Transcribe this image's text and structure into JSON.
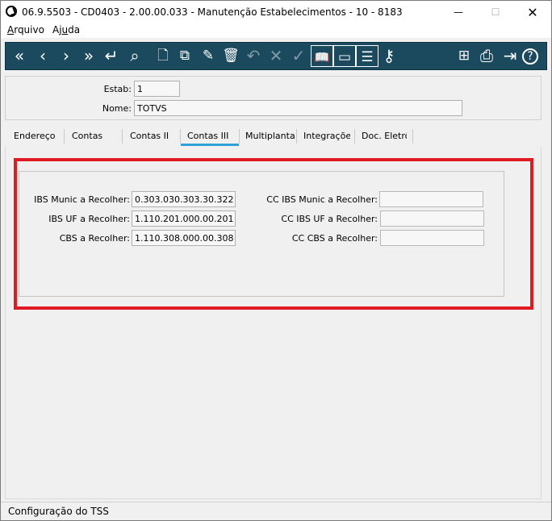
{
  "window": {
    "title": "06.9.5503 - CD0403 - 2.00.00.033 - Manutenção Estabelecimentos - 10 - 8183",
    "minimize": "—",
    "maximize": "☐",
    "close": "✕"
  },
  "menu": {
    "items": [
      {
        "label_u": "A",
        "label_rest": "rquivo"
      },
      {
        "label_pre": "Aj",
        "label_u": "u",
        "label_rest": "da"
      }
    ]
  },
  "toolbar": {
    "buttons": [
      {
        "icon": "first-record-icon",
        "glyph": "«"
      },
      {
        "icon": "previous-record-icon",
        "glyph": "‹"
      },
      {
        "icon": "next-record-icon",
        "glyph": "›"
      },
      {
        "icon": "last-record-icon",
        "glyph": "»"
      },
      {
        "icon": "goto-record-icon",
        "glyph": "↵"
      },
      {
        "icon": "search-icon",
        "glyph": "⌕"
      },
      {
        "icon": "new-record-icon",
        "glyph": "🗋"
      },
      {
        "icon": "copy-record-icon",
        "glyph": "⧉"
      },
      {
        "icon": "edit-record-icon",
        "glyph": "✎"
      },
      {
        "icon": "delete-record-icon",
        "glyph": "🗑"
      },
      {
        "icon": "undo-icon",
        "glyph": "↶"
      },
      {
        "icon": "cancel-icon",
        "glyph": "✕"
      },
      {
        "icon": "save-icon",
        "glyph": "✓"
      },
      {
        "icon": "book-icon",
        "glyph": "📖"
      },
      {
        "icon": "cast-icon",
        "glyph": "▭"
      },
      {
        "icon": "settings-sliders-icon",
        "glyph": "☰"
      },
      {
        "icon": "key-icon",
        "glyph": "⚷"
      },
      {
        "icon": "tree-structure-icon",
        "glyph": "⊞"
      },
      {
        "icon": "print-icon",
        "glyph": "⎙"
      },
      {
        "icon": "exit-icon",
        "glyph": "⇥"
      },
      {
        "icon": "help-icon",
        "glyph": "?"
      }
    ]
  },
  "header": {
    "estab_label": "Estab:",
    "estab_value": "1",
    "nome_label": "Nome:",
    "nome_value": "TOTVS"
  },
  "tabs": [
    {
      "label": "Endereço"
    },
    {
      "label": "Contas"
    },
    {
      "label": "Contas II"
    },
    {
      "label": "Contas III",
      "active": true
    },
    {
      "label": "Multiplanta"
    },
    {
      "label": "Integrações"
    },
    {
      "label": "Doc. Eletrô"
    }
  ],
  "contas3": {
    "ibs_munic_label": "IBS Munic a Recolher:",
    "ibs_munic_value": "0.303.030.303.30.322",
    "ibs_uf_label": "IBS UF a Recolher:",
    "ibs_uf_value": "1.110.201.000.00.201",
    "cbs_label": "CBS a Recolher:",
    "cbs_value": "1.110.308.000.00.308",
    "cc_ibs_munic_label": "CC IBS Munic a Recolher:",
    "cc_ibs_munic_value": "",
    "cc_ibs_uf_label": "CC IBS UF a Recolher:",
    "cc_ibs_uf_value": "",
    "cc_cbs_label": "CC CBS a Recolher:",
    "cc_cbs_value": ""
  },
  "status": {
    "text": "Configuração do TSS"
  },
  "colors": {
    "toolbar_bg": "#1b4a5e",
    "tab_active_underline": "#2fa0d8",
    "highlight_border": "#e01a22"
  }
}
